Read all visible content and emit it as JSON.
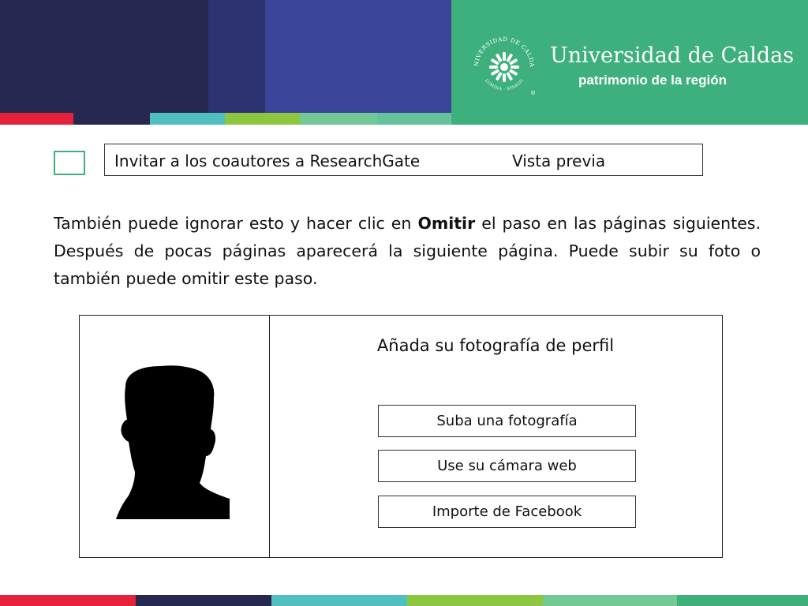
{
  "header": {
    "university_name": "Universidad de Caldas",
    "tagline": "patrimonio de la región",
    "seal": {
      "ring_text_top": "UNIVERSIDAD DE CALDAS",
      "ring_text_bottom": "LUMINA · SPARGO",
      "registered_mark": "®"
    }
  },
  "invite": {
    "checked": false,
    "label": "Invitar a los coautores a ResearchGate",
    "preview_label": "Vista previa"
  },
  "paragraph": {
    "before": "También puede ignorar esto y hacer clic en ",
    "bold": "Omitir",
    "after": " el paso en las páginas siguientes. Después de pocas páginas aparecerá la siguiente página. Puede subir su foto o también puede omitir este paso."
  },
  "photo_panel": {
    "title": "Añada su fotografía de perfil",
    "buttons": {
      "upload": "Suba una fotografía",
      "webcam": "Use su cámara web",
      "facebook": "Importe de Facebook"
    }
  },
  "colors": {
    "navy_dark": "#26284f",
    "navy": "#2d3270",
    "blue": "#3a4498",
    "green": "#3db07e",
    "red": "#e5213c",
    "teal": "#4fbfbf",
    "lime": "#8dc63f",
    "mint": "#73c996"
  }
}
